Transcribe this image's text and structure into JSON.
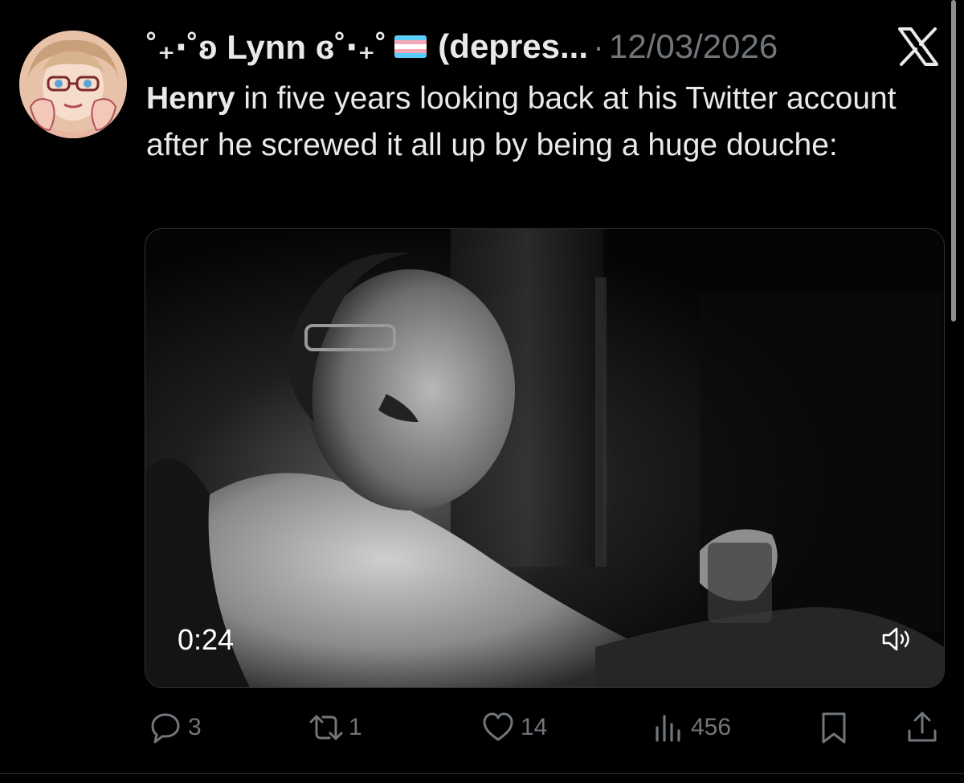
{
  "tweet": {
    "author": {
      "display_name": "˚₊‧˚ʚ Lynn ɞ˚‧₊˚",
      "name_suffix": "(depres...",
      "separator": "·",
      "date": "12/03/2026",
      "avatar_icon": "avatar-icon"
    },
    "brand_logo": "X",
    "text": {
      "highlight": "Henry",
      "body": " in five years looking back at his Twitter account after he screwed it all up by being a huge douche:"
    },
    "media": {
      "type": "video",
      "duration": "0:24",
      "volume_icon": "speaker-icon"
    },
    "actions": {
      "reply_count": "3",
      "repost_count": "1",
      "like_count": "14",
      "view_count": "456"
    },
    "flag_colors": [
      "#5bcefa",
      "#f5a9b8",
      "#ffffff",
      "#f5a9b8",
      "#5bcefa"
    ],
    "accent_gray": "#71767b",
    "text_color": "#e7e9ea"
  }
}
